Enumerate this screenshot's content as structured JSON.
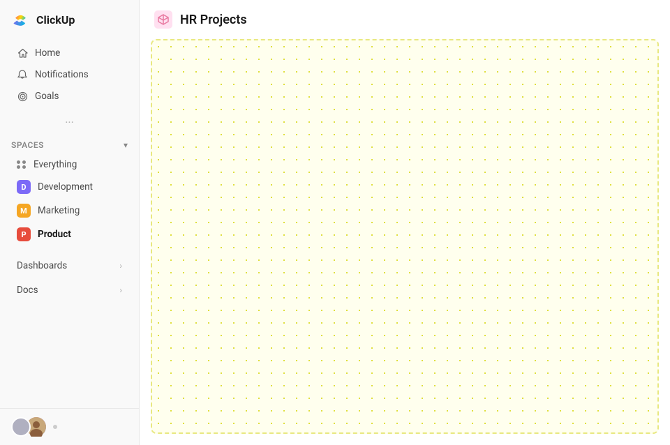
{
  "logo": {
    "text": "ClickUp"
  },
  "nav": {
    "items": [
      {
        "id": "home",
        "label": "Home",
        "icon": "home-icon"
      },
      {
        "id": "notifications",
        "label": "Notifications",
        "icon": "bell-icon"
      },
      {
        "id": "goals",
        "label": "Goals",
        "icon": "target-icon"
      }
    ]
  },
  "spaces": {
    "label": "Spaces",
    "chevron": "▾",
    "items": [
      {
        "id": "everything",
        "label": "Everything",
        "type": "grid"
      },
      {
        "id": "development",
        "label": "Development",
        "color": "#7c6af7",
        "initial": "D"
      },
      {
        "id": "marketing",
        "label": "Marketing",
        "color": "#f5a623",
        "initial": "M"
      },
      {
        "id": "product",
        "label": "Product",
        "color": "#e74c3c",
        "initial": "P",
        "active": true
      }
    ]
  },
  "expandable": [
    {
      "id": "dashboards",
      "label": "Dashboards"
    },
    {
      "id": "docs",
      "label": "Docs"
    }
  ],
  "main": {
    "page_icon": "cube-icon",
    "page_title": "HR Projects"
  },
  "bottom": {
    "status_label": "•"
  }
}
